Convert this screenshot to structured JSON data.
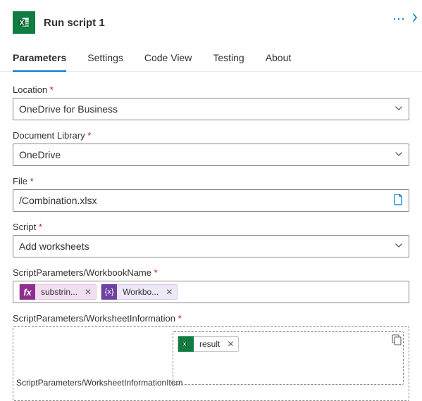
{
  "header": {
    "title": "Run script 1"
  },
  "tabs": [
    {
      "label": "Parameters",
      "active": true
    },
    {
      "label": "Settings",
      "active": false
    },
    {
      "label": "Code View",
      "active": false
    },
    {
      "label": "Testing",
      "active": false
    },
    {
      "label": "About",
      "active": false
    }
  ],
  "fields": {
    "location": {
      "label": "Location",
      "value": "OneDrive for Business"
    },
    "docLibrary": {
      "label": "Document Library",
      "value": "OneDrive"
    },
    "file": {
      "label": "File",
      "value": "/Combination.xlsx"
    },
    "script": {
      "label": "Script",
      "value": "Add worksheets"
    },
    "workbookName": {
      "label": "ScriptParameters/WorkbookName",
      "tokens": [
        {
          "kind": "fx",
          "iconText": "fx",
          "label": "substrin..."
        },
        {
          "kind": "var",
          "iconText": "{x}",
          "label": "Workbo..."
        }
      ]
    },
    "worksheetInfo": {
      "label": "ScriptParameters/WorksheetInformation",
      "itemLabel": "ScriptParameters/WorksheetInformationItem",
      "token": {
        "kind": "result",
        "iconText": "",
        "label": "result"
      }
    }
  }
}
